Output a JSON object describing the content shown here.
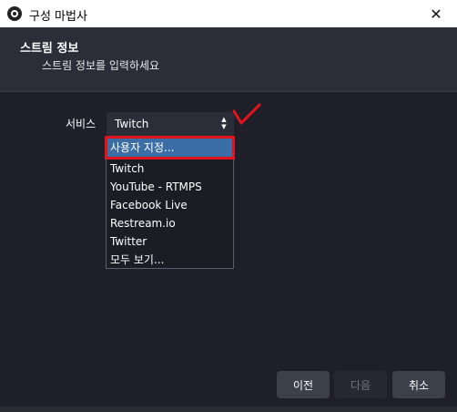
{
  "window": {
    "title": "구성 마법사",
    "close_glyph": "✕"
  },
  "header": {
    "title": "스트림 정보",
    "subtitle": "스트림 정보를 입력하세요"
  },
  "service": {
    "label": "서비스",
    "selected": "Twitch",
    "options": [
      "사용자 지정...",
      "Twitch",
      "YouTube - RTMPS",
      "Facebook Live",
      "Restream.io",
      "Twitter",
      "모두 보기..."
    ],
    "highlighted_option": "사용자 지정..."
  },
  "footer": {
    "back_label": "이전",
    "next_label": "다음",
    "cancel_label": "취소"
  },
  "colors": {
    "dark_bg": "#1e1f29",
    "header_bg": "#2b2e38",
    "highlight_blue": "#3a6ea5",
    "annotation_red": "#e3131b"
  }
}
